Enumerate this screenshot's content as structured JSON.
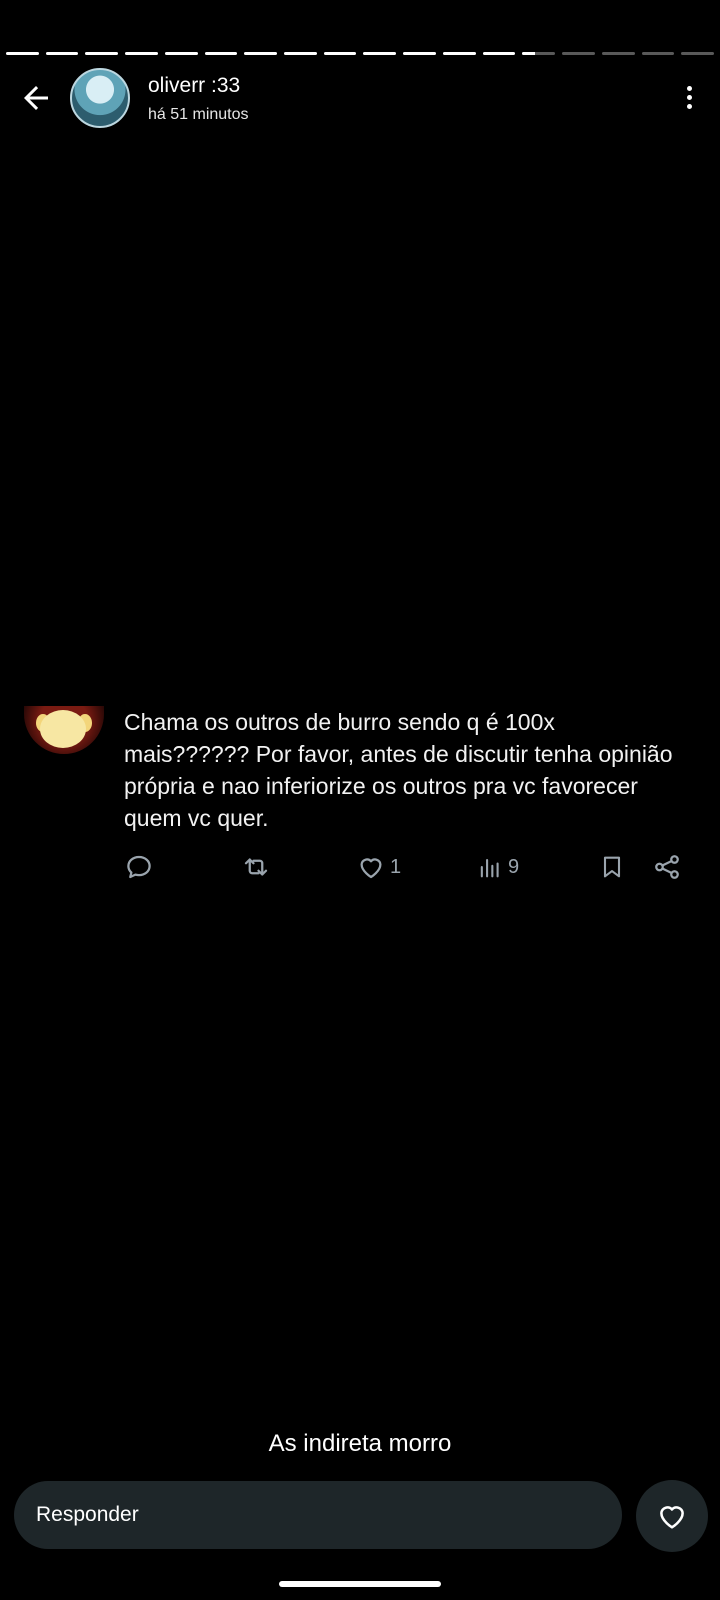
{
  "story": {
    "segments": [
      1,
      1,
      1,
      1,
      1,
      1,
      1,
      1,
      1,
      1,
      1,
      1,
      1,
      0.4,
      0,
      0,
      0,
      0
    ],
    "user_name": "oliverr :33",
    "time_ago": "há 51 minutos"
  },
  "tweet": {
    "text": "Chama os outros de burro sendo q é 100x mais?????? Por favor, antes de discutir tenha opinião própria e nao inferiorize os outros pra vc favorecer quem vc quer.",
    "likes": "1",
    "views": "9"
  },
  "caption": "As indireta morro",
  "reply_placeholder": "Responder",
  "icons": [
    "back-arrow-icon",
    "more-vert-icon",
    "reply-icon",
    "retweet-icon",
    "heart-icon",
    "views-icon",
    "bookmark-icon",
    "share-icon"
  ],
  "colors": {
    "background": "#000000",
    "input_bg": "#1e2629",
    "action_gray": "#9aa4ad"
  }
}
